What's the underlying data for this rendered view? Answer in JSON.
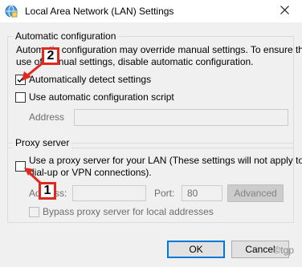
{
  "window": {
    "title": "Local Area Network (LAN) Settings",
    "icon": "network-settings-icon",
    "close_glyph": "✕"
  },
  "automatic_configuration": {
    "legend": "Automatic configuration",
    "description_line1": "Automatic configuration may override manual settings.  To ensure the",
    "description_line2": "use of manual settings, disable automatic configuration.",
    "auto_detect": {
      "label": "Automatically detect settings",
      "checked": true
    },
    "auto_script": {
      "label": "Use automatic configuration script",
      "checked": false
    },
    "address_label": "Address",
    "address_value": ""
  },
  "proxy_server": {
    "legend": "Proxy server",
    "use_proxy": {
      "label_line1": "Use a proxy server for your LAN (These settings will not apply to",
      "label_line2": "dial-up or VPN connections).",
      "checked": false
    },
    "address_label": "Address:",
    "address_value": "",
    "port_label": "Port:",
    "port_value": "80",
    "advanced_label": "Advanced",
    "bypass": {
      "label": "Bypass proxy server for local addresses",
      "checked": false
    }
  },
  "buttons": {
    "ok": "OK",
    "cancel": "Cancel"
  },
  "annotations": {
    "badge_1": "1",
    "badge_2": "2",
    "color": "#e0281e"
  },
  "watermark": "©tgp"
}
